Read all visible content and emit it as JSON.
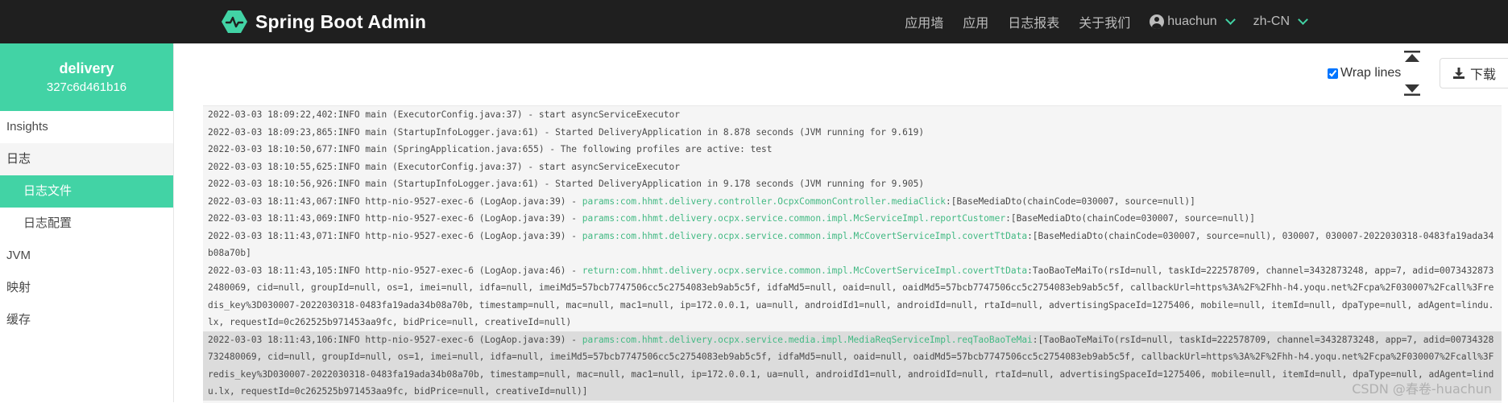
{
  "navbar": {
    "brand": "Spring Boot Admin",
    "items": [
      "应用墙",
      "应用",
      "日志报表",
      "关于我们"
    ],
    "user": "huachun",
    "locale": "zh-CN"
  },
  "sidebar": {
    "app_name": "delivery",
    "app_id": "327c6d461b16",
    "items": [
      {
        "label": "Insights"
      },
      {
        "label": "日志"
      },
      {
        "label": "日志文件"
      },
      {
        "label": "日志配置"
      },
      {
        "label": "JVM"
      },
      {
        "label": "映射"
      },
      {
        "label": "缓存"
      }
    ]
  },
  "toolbar": {
    "wrap_lines_label": "Wrap lines",
    "wrap_lines_checked": true,
    "download_label": "下载"
  },
  "log_lines": [
    {
      "pre": "2022-03-03 18:09:22,402:INFO main (ExecutorConfig.java:37) - start asyncServiceExecutor",
      "green": "",
      "post": ""
    },
    {
      "pre": "2022-03-03 18:09:23,865:INFO main (StartupInfoLogger.java:61) - Started DeliveryApplication in 8.878 seconds (JVM running for 9.619)",
      "green": "",
      "post": ""
    },
    {
      "pre": "2022-03-03 18:10:50,677:INFO main (SpringApplication.java:655) - The following profiles are active: test",
      "green": "",
      "post": ""
    },
    {
      "pre": "2022-03-03 18:10:55,625:INFO main (ExecutorConfig.java:37) - start asyncServiceExecutor",
      "green": "",
      "post": ""
    },
    {
      "pre": "2022-03-03 18:10:56,926:INFO main (StartupInfoLogger.java:61) - Started DeliveryApplication in 9.178 seconds (JVM running for 9.905)",
      "green": "",
      "post": ""
    },
    {
      "pre": "2022-03-03 18:11:43,067:INFO http-nio-9527-exec-6 (LogAop.java:39) - ",
      "green": "params:com.hhmt.delivery.controller.OcpxCommonController.mediaClick",
      "post": ":[BaseMediaDto(chainCode=030007, source=null)]"
    },
    {
      "pre": "2022-03-03 18:11:43,069:INFO http-nio-9527-exec-6 (LogAop.java:39) - ",
      "green": "params:com.hhmt.delivery.ocpx.service.common.impl.McServiceImpl.reportCustomer",
      "post": ":[BaseMediaDto(chainCode=030007, source=null)]"
    },
    {
      "pre": "2022-03-03 18:11:43,071:INFO http-nio-9527-exec-6 (LogAop.java:39) - ",
      "green": "params:com.hhmt.delivery.ocpx.service.common.impl.McCovertServiceImpl.covertTtData",
      "post": ":[BaseMediaDto(chainCode=030007, source=null), 030007, 030007-2022030318-0483fa19ada34b08a70b]"
    },
    {
      "pre": "2022-03-03 18:11:43,105:INFO http-nio-9527-exec-6 (LogAop.java:46) - ",
      "green": "return:com.hhmt.delivery.ocpx.service.common.impl.McCovertServiceImpl.covertTtData",
      "post": ":TaoBaoTeMaiTo(rsId=null, taskId=222578709, channel=3432873248, app=7, adid=00734328732480069, cid=null, groupId=null, os=1, imei=null, idfa=null, imeiMd5=57bcb7747506cc5c2754083eb9ab5c5f, idfaMd5=null, oaid=null, oaidMd5=57bcb7747506cc5c2754083eb9ab5c5f, callbackUrl=https%3A%2F%2Fhh-h4.yoqu.net%2Fcpa%2F030007%2Fcall%3Fredis_key%3D030007-2022030318-0483fa19ada34b08a70b, timestamp=null, mac=null, mac1=null, ip=172.0.0.1, ua=null, androidId1=null, androidId=null, rtaId=null, advertisingSpaceId=1275406, mobile=null, itemId=null, dpaType=null, adAgent=lindu.lx, requestId=0c262525b971453aa9fc, bidPrice=null, creativeId=null)"
    },
    {
      "pre": "2022-03-03 18:11:43,106:INFO http-nio-9527-exec-6 (LogAop.java:39) - ",
      "green": "params:com.hhmt.delivery.ocpx.service.media.impl.MediaReqServiceImpl.reqTaoBaoTeMai",
      "post": ":[TaoBaoTeMaiTo(rsId=null, taskId=222578709, channel=3432873248, app=7, adid=00734328732480069, cid=null, groupId=null, os=1, imei=null, idfa=null, imeiMd5=57bcb7747506cc5c2754083eb9ab5c5f, idfaMd5=null, oaid=null, oaidMd5=57bcb7747506cc5c2754083eb9ab5c5f, callbackUrl=https%3A%2F%2Fhh-h4.yoqu.net%2Fcpa%2F030007%2Fcall%3Fredis_key%3D030007-2022030318-0483fa19ada34b08a70b, timestamp=null, mac=null, mac1=null, ip=172.0.0.1, ua=null, androidId1=null, androidId=null, rtaId=null, advertisingSpaceId=1275406, mobile=null, itemId=null, dpaType=null, adAgent=lindu.lx, requestId=0c262525b971453aa9fc, bidPrice=null, creativeId=null)]",
      "highlight": true
    }
  ],
  "watermark": "CSDN @春卷-huachun",
  "colors": {
    "accent": "#42d3a5",
    "navbar_bg": "#1f1f1f",
    "log_green": "#42b983"
  },
  "icons": [
    "brand-logo-icon",
    "user-icon",
    "chevron-down-icon",
    "scroll-to-top-icon",
    "scroll-to-bottom-icon",
    "download-icon"
  ]
}
